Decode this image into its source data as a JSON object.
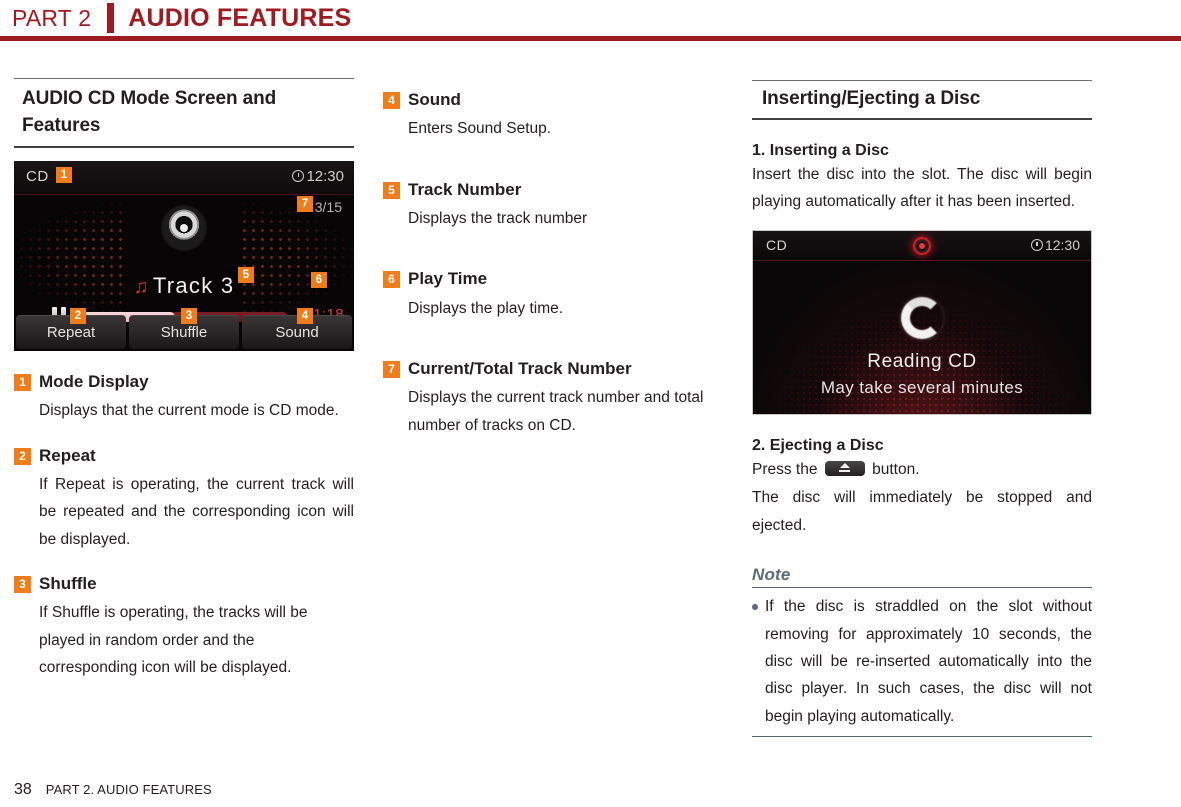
{
  "header": {
    "part": "PART 2",
    "title": "AUDIO FEATURES"
  },
  "column_left": {
    "section_title": "AUDIO CD Mode Screen and Features",
    "cd_screen": {
      "mode_label": "CD",
      "clock": "12:30",
      "track_counter": "3/15",
      "track_name": "Track  3",
      "music_note": "♫",
      "play_time": "01:18",
      "buttons": [
        "Repeat",
        "Shuffle",
        "Sound"
      ],
      "callouts": [
        "1",
        "2",
        "3",
        "4",
        "5",
        "6",
        "7"
      ],
      "progress_percent": 45
    },
    "items": [
      {
        "number": "1",
        "title": "Mode Display",
        "body": "Displays that the current mode is CD mode."
      },
      {
        "number": "2",
        "title": "Repeat",
        "body": "If Repeat is operating, the current track will be repeated and the corresponding icon will be displayed."
      },
      {
        "number": "3",
        "title": "Shuffle",
        "body": "If Shuffle is operating, the tracks will be played in random order and the corresponding icon will be displayed."
      }
    ]
  },
  "column_middle": {
    "items": [
      {
        "number": "4",
        "title": "Sound",
        "body": "Enters Sound Setup."
      },
      {
        "number": "5",
        "title": "Track Number",
        "body": "Displays the track number"
      },
      {
        "number": "6",
        "title": "Play Time",
        "body": "Displays the play time."
      },
      {
        "number": "7",
        "title": "Current/Total Track Number",
        "body": "Displays the current track number and total number of tracks on CD."
      }
    ]
  },
  "column_right": {
    "section_title": "Inserting/Ejecting a Disc",
    "inserting": {
      "heading": "1. Inserting a Disc",
      "body": "Insert the disc into the slot. The disc will begin playing automatically after it has been inserted."
    },
    "reading_screen": {
      "mode_label": "CD",
      "clock": "12:30",
      "line1": "Reading CD",
      "line2": "May take several minutes"
    },
    "ejecting": {
      "heading": "2. Ejecting a Disc",
      "press_prefix": "Press the",
      "press_suffix": "button.",
      "body": "The disc will immediately be stopped and ejected."
    },
    "note": {
      "title": "Note",
      "bullets": [
        "If the disc is straddled on the slot without removing for approximately 10 seconds, the disc will be re-inserted automatically into the disc player. In such cases, the disc will not begin playing automatically."
      ]
    }
  },
  "footer": {
    "page_number": "38",
    "text": "PART 2. AUDIO FEATURES"
  },
  "colors": {
    "brand_red": "#9e1b21",
    "callout_orange": "#f07d1a",
    "note_blue": "#5b6a7d",
    "body_text": "#231f20"
  }
}
